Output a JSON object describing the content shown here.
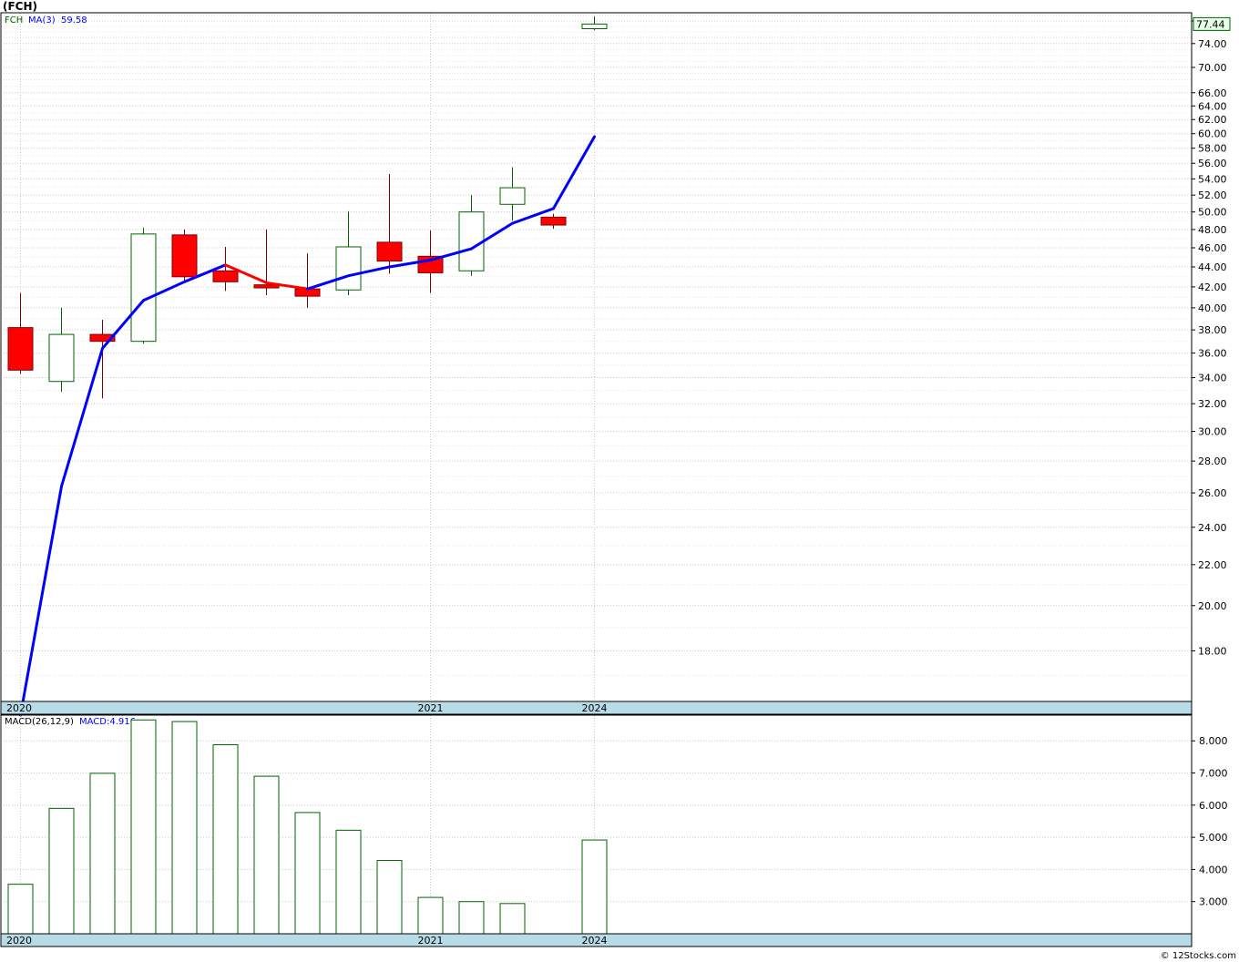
{
  "title": "(FCH)",
  "copyright": "© 12Stocks.com",
  "colors": {
    "up": "#006400",
    "down": "#ff0000",
    "ma": "#0000ff",
    "ma_down": "#ff0000",
    "grid": "#c8c8c8",
    "date_band": "#b7dce8",
    "last_label": "#e6ffe6"
  },
  "chart_data": [
    {
      "type": "candlestick",
      "title": "(FCH)",
      "legend": {
        "symbol": "FCH",
        "ma_label": "MA(3)",
        "ma_value": "59.58"
      },
      "scale": "log",
      "ylim": [
        16.0,
        79.5
      ],
      "y_ticks": [
        18.0,
        20.0,
        22.0,
        24.0,
        26.0,
        28.0,
        30.0,
        32.0,
        34.0,
        36.0,
        38.0,
        40.0,
        42.0,
        44.0,
        46.0,
        48.0,
        50.0,
        52.0,
        54.0,
        56.0,
        58.0,
        60.0,
        62.0,
        64.0,
        66.0,
        70.0,
        74.0,
        78.0
      ],
      "x_labels": [
        {
          "label": "2020",
          "index": 0
        },
        {
          "label": "2021",
          "index": 10
        },
        {
          "label": "2024",
          "index": 14
        }
      ],
      "last_price_label": "77.44",
      "candles": [
        {
          "open": 38.2,
          "high": 41.4,
          "low": 34.3,
          "close": 34.6
        },
        {
          "open": 33.7,
          "high": 40.0,
          "low": 32.9,
          "close": 37.6
        },
        {
          "open": 37.6,
          "high": 38.9,
          "low": 32.4,
          "close": 37.0
        },
        {
          "open": 37.0,
          "high": 48.2,
          "low": 36.8,
          "close": 47.5
        },
        {
          "open": 47.4,
          "high": 48.0,
          "low": 42.6,
          "close": 43.0
        },
        {
          "open": 43.6,
          "high": 46.1,
          "low": 41.6,
          "close": 42.5
        },
        {
          "open": 42.2,
          "high": 48.0,
          "low": 41.2,
          "close": 41.9
        },
        {
          "open": 41.8,
          "high": 45.4,
          "low": 40.0,
          "close": 41.1
        },
        {
          "open": 41.7,
          "high": 50.1,
          "low": 41.2,
          "close": 46.1
        },
        {
          "open": 46.6,
          "high": 54.6,
          "low": 43.3,
          "close": 44.6
        },
        {
          "open": 45.1,
          "high": 47.9,
          "low": 41.4,
          "close": 43.4
        },
        {
          "open": 43.6,
          "high": 52.0,
          "low": 43.1,
          "close": 50.0
        },
        {
          "open": 50.9,
          "high": 55.5,
          "low": 49.0,
          "close": 52.9
        },
        {
          "open": 49.4,
          "high": 49.8,
          "low": 48.1,
          "close": 48.5
        },
        {
          "open": 76.6,
          "high": 78.8,
          "low": 76.3,
          "close": 77.44
        }
      ],
      "ma": [
        15.5,
        26.4,
        36.4,
        40.7,
        42.5,
        44.2,
        42.4,
        41.8,
        43.1,
        44.0,
        44.7,
        45.9,
        48.7,
        50.4,
        59.58
      ]
    },
    {
      "type": "bar",
      "title": "MACD",
      "legend": {
        "label": "MACD(26,12,9)",
        "macd_label": "MACD:4.916"
      },
      "ylim": [
        2.0,
        8.8
      ],
      "y_ticks": [
        3.0,
        4.0,
        5.0,
        6.0,
        7.0,
        8.0
      ],
      "x_labels": [
        {
          "label": "2020",
          "index": 0
        },
        {
          "label": "2021",
          "index": 10
        },
        {
          "label": "2024",
          "index": 14
        }
      ],
      "values": [
        3.54,
        5.9,
        6.99,
        8.65,
        8.6,
        7.88,
        6.9,
        5.77,
        5.22,
        4.28,
        3.13,
        3.0,
        2.94,
        null,
        4.916
      ]
    }
  ]
}
